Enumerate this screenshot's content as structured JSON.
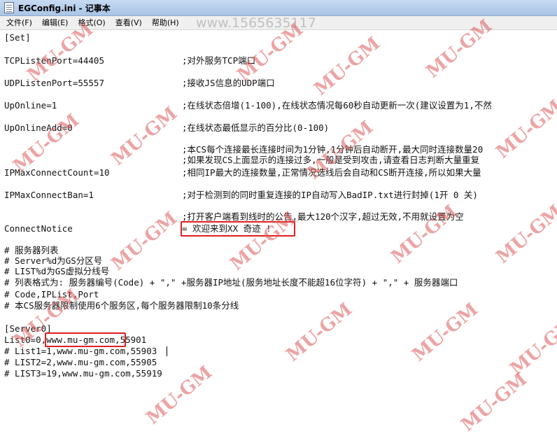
{
  "window": {
    "title": "EGConfig.ini - 记事本"
  },
  "menu": [
    "文件(F)",
    "编辑(E)",
    "格式(O)",
    "查看(V)",
    "帮助(H)"
  ],
  "lines": [
    {
      "key": "[Set]",
      "comment": ""
    },
    {
      "key": "TCPListenPort=44405",
      "comment": ";对外服务TCP端口"
    },
    {
      "key": "UDPListenPort=55557",
      "comment": ";接收JS信息的UDP端口"
    },
    {
      "key": "UpOnline=1",
      "comment": ";在线状态倍增(1-100),在线状态情况每60秒自动更新一次(建议设置为1,不然"
    },
    {
      "key": "UpOnlineAdd=0",
      "comment": ";在线状态最低显示的百分比(0-100)"
    },
    {
      "key": "",
      "comment": ";本CS每个连接最长连接时间为1分钟,1分钟后自动断开,最大同时连接数量20"
    },
    {
      "key": "",
      "comment": ";如果发现CS上面显示的连接过多,一般是受到攻击,请查看日志判断大量重复"
    },
    {
      "key": "IPMaxConnectCount=10",
      "comment": ";相同IP最大的连接数量,正常情况选线后会自动和CS断开连接,所以如果大量"
    },
    {
      "key": "IPMaxConnectBan=1",
      "comment": ";对于检测到的同时重复连接的IP自动写入BadIP.txt进行封掉(1开 0 关)"
    },
    {
      "key": "",
      "comment": ";打开客户端看到线时的公告,最大120个汉字,超过无效,不用就设置为空"
    },
    {
      "key": "ConnectNotice",
      "comment": "= 欢迎来到XX 奇迹 !"
    },
    {
      "key": "# 服务器列表",
      "comment": ""
    },
    {
      "key": "# Server%d为GS分区号",
      "comment": ""
    },
    {
      "key": "# LIST%d为GS虚拟分线号",
      "comment": ""
    },
    {
      "key": "# 列表格式为: 服务器编号(Code) + \",\" +服务器IP地址(服务地址长度不能超16位字符) + \",\" + 服务器端口",
      "comment": ""
    },
    {
      "key": "# Code,IPList,Port",
      "comment": ""
    },
    {
      "key": "# 本CS服务器限制使用6个服务区,每个服务器限制10条分线",
      "comment": ""
    },
    {
      "key": "[Server0]",
      "comment": ""
    },
    {
      "key": "List0=0,www.mu-gm.com,55901",
      "comment": ""
    },
    {
      "key": "# List1=1,www.mu-gm.com,55903",
      "comment": ""
    },
    {
      "key": "# LIST2=2,www.mu-gm.com,55905",
      "comment": ""
    },
    {
      "key": "# LIST3=19,www.mu-gm.com,55919",
      "comment": ""
    }
  ],
  "watermark": {
    "text": "MU-GM",
    "top_text": "www.1565635117"
  }
}
